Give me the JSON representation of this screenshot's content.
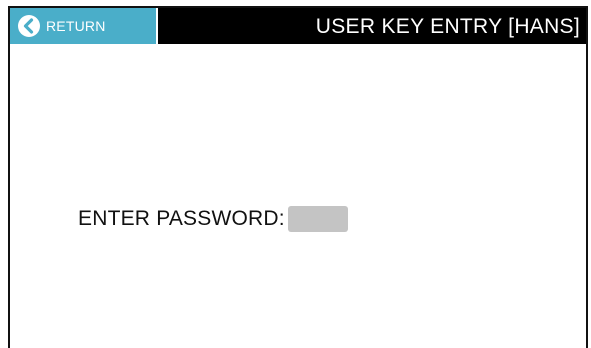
{
  "header": {
    "return_label": "RETURN",
    "return_icon": "chevron-left-circle-icon",
    "title": "USER KEY ENTRY [HANS]"
  },
  "password": {
    "label": "ENTER PASSWORD:",
    "value": "",
    "placeholder": ""
  },
  "colors": {
    "title_bar": "#000000",
    "return_button": "#4aaec9",
    "password_field": "#c4c4c4",
    "background": "#ffffff"
  }
}
